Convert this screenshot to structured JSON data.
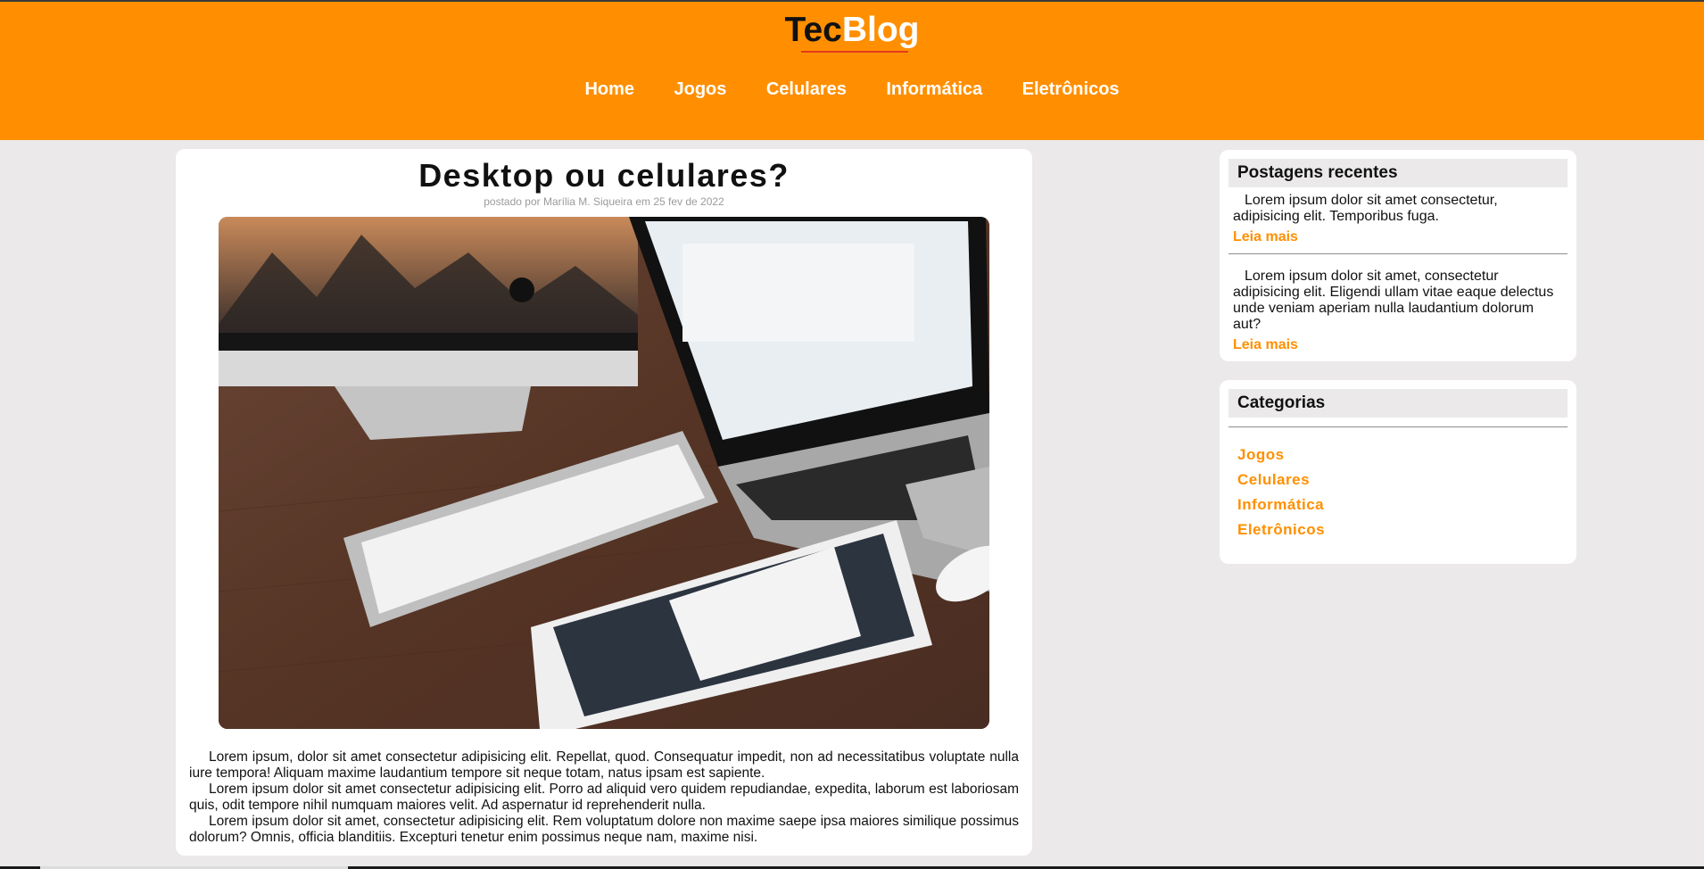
{
  "header": {
    "logo_part1": "Tec",
    "logo_part2": "Blog",
    "nav": [
      "Home",
      "Jogos",
      "Celulares",
      "Informática",
      "Eletrônicos"
    ],
    "colors": {
      "brand": "#ff8f00",
      "logo_dark": "#111111",
      "logo_light": "#ffffff",
      "underline": "#e33b1a"
    }
  },
  "article": {
    "title": "Desktop ou celulares?",
    "meta": "postado por Marília M. Siqueira em 25 fev de 2022",
    "image_icon": "desk-with-imac-macbook-ipad-photo",
    "paragraphs": [
      "Lorem ipsum, dolor sit amet consectetur adipisicing elit. Repellat, quod. Consequatur impedit, non ad necessitatibus voluptate nulla iure tempora! Aliquam maxime laudantium tempore sit neque totam, natus ipsam est sapiente.",
      "Lorem ipsum dolor sit amet consectetur adipisicing elit. Porro ad aliquid vero quidem repudiandae, expedita, laborum est laboriosam quis, odit tempore nihil numquam maiores velit. Ad aspernatur id reprehenderit nulla.",
      "Lorem ipsum dolor sit amet, consectetur adipisicing elit. Rem voluptatum dolore non maxime saepe ipsa maiores similique possimus dolorum? Omnis, officia blanditiis. Excepturi tenetur enim possimus neque nam, maxime nisi."
    ]
  },
  "recent": {
    "heading": "Postagens recentes",
    "items": [
      {
        "text": "Lorem ipsum dolor sit amet consectetur, adipisicing elit. Temporibus fuga.",
        "link": "Leia mais"
      },
      {
        "text": "Lorem ipsum dolor sit amet, consectetur adipisicing elit. Eligendi ullam vitae eaque delectus unde veniam aperiam nulla laudantium dolorum aut?",
        "link": "Leia mais"
      }
    ]
  },
  "categories": {
    "heading": "Categorias",
    "items": [
      "Jogos",
      "Celulares",
      "Informática",
      "Eletrônicos"
    ]
  }
}
